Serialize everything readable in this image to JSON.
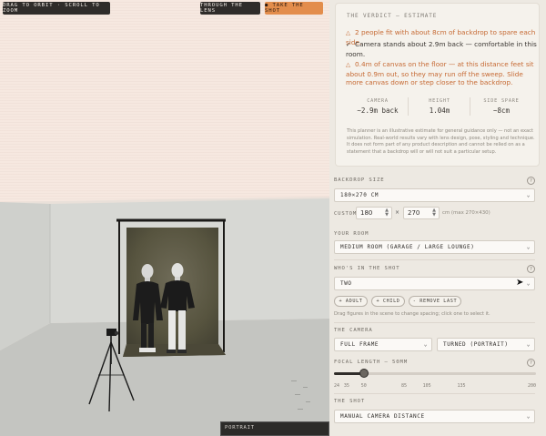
{
  "viewport": {
    "hint": "DRAG TO ORBIT · SCROLL TO ZOOM",
    "lens_button": "THROUGH THE LENS",
    "shot_button": "● TAKE THE SHOT",
    "orientation_tag": "PORTRAIT"
  },
  "verdict": {
    "title": "THE VERDICT — ESTIMATE",
    "lines": [
      {
        "status": "warn",
        "mark": "△",
        "text": "2 people fit with about 8cm of backdrop to spare each side."
      },
      {
        "status": "ok",
        "mark": "✓",
        "text": "Camera stands about 2.9m back — comfortable in this room."
      },
      {
        "status": "warn",
        "mark": "△",
        "text": "0.4m of canvas on the floor — at this distance feet sit about 0.9m out, so they may run off the sweep. Slide more canvas down or step closer to the backdrop."
      }
    ],
    "stats": [
      {
        "label": "CAMERA",
        "value": "~2.9m back"
      },
      {
        "label": "HEIGHT",
        "value": "1.04m"
      },
      {
        "label": "SIDE SPARE",
        "value": "~8cm"
      }
    ],
    "note": "This planner is an illustrative estimate for general guidance only — not an exact simulation. Real-world results vary with lens design, pose, styling and technique. It does not form part of any product description and cannot be relied on as a statement that a backdrop will or will not suit a particular setup."
  },
  "backdrop": {
    "label": "BACKDROP SIZE",
    "selected": "180×270 CM",
    "custom_label": "CUSTOM",
    "width": "180",
    "height": "270",
    "times": "×",
    "max_note": "cm (max 270×430)"
  },
  "room": {
    "label": "YOUR ROOM",
    "selected": "MEDIUM ROOM (GARAGE / LARGE LOUNGE)"
  },
  "shot_people": {
    "label": "WHO'S IN THE SHOT",
    "selected": "TWO",
    "chips": [
      "+ ADULT",
      "+ CHILD",
      "- REMOVE LAST"
    ],
    "hint": "Drag figures in the scene to change spacing; click one to select it."
  },
  "camera": {
    "label": "THE CAMERA",
    "sensor": "FULL FRAME",
    "orientation": "TURNED (PORTRAIT)"
  },
  "focal": {
    "label": "FOCAL LENGTH — 50MM",
    "min": 24,
    "max": 200,
    "value": 50,
    "ticks": [
      "24",
      "35",
      "50",
      "85",
      "105",
      "135",
      "200"
    ]
  },
  "shot": {
    "label": "THE SHOT",
    "selected": "MANUAL CAMERA DISTANCE"
  },
  "help_mark": "?",
  "chevron": "⌄",
  "colors": {
    "accent": "#e38d4c",
    "warn": "#c66a34",
    "dark": "#2f2c2a",
    "panel": "#ede9e2"
  }
}
